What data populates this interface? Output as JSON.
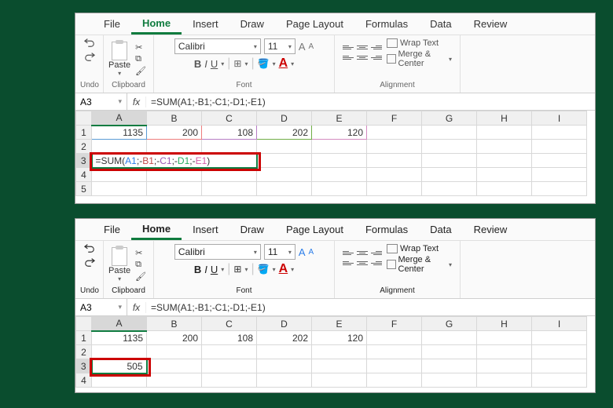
{
  "tabs": [
    "File",
    "Home",
    "Insert",
    "Draw",
    "Page Layout",
    "Formulas",
    "Data",
    "Review"
  ],
  "ribbon": {
    "undo_label": "Undo",
    "clipboard_label": "Clipboard",
    "paste_label": "Paste",
    "font_label": "Font",
    "font_name": "Calibri",
    "font_size": "11",
    "alignment_label": "Alignment",
    "wrap_text": "Wrap Text",
    "merge_center": "Merge & Center",
    "bold": "B",
    "italic": "I",
    "underline": "U",
    "font_a_large": "A",
    "font_a_small": "A"
  },
  "namebox": "A3",
  "formula_bar": "=SUM(A1;-B1;-C1;-D1;-E1)",
  "columns": [
    "A",
    "B",
    "C",
    "D",
    "E",
    "F",
    "G",
    "H",
    "I"
  ],
  "rows": [
    "1",
    "2",
    "3",
    "4",
    "5"
  ],
  "win1": {
    "row1": [
      "1135",
      "200",
      "108",
      "202",
      "120",
      "",
      "",
      "",
      ""
    ],
    "a3_formula_parts": [
      {
        "t": "=SUM(",
        "c": "#333"
      },
      {
        "t": "A1",
        "c": "#2b7de9"
      },
      {
        "t": ";-",
        "c": "#333"
      },
      {
        "t": "B1",
        "c": "#c04848"
      },
      {
        "t": ";-",
        "c": "#333"
      },
      {
        "t": "C1",
        "c": "#9b59b6"
      },
      {
        "t": ";-",
        "c": "#333"
      },
      {
        "t": "D1",
        "c": "#27ae60"
      },
      {
        "t": ";-",
        "c": "#333"
      },
      {
        "t": "E1",
        "c": "#d35fa8"
      },
      {
        "t": ")",
        "c": "#333"
      }
    ]
  },
  "win2": {
    "row1": [
      "1135",
      "200",
      "108",
      "202",
      "120",
      "",
      "",
      "",
      ""
    ],
    "a3_result": "505"
  }
}
